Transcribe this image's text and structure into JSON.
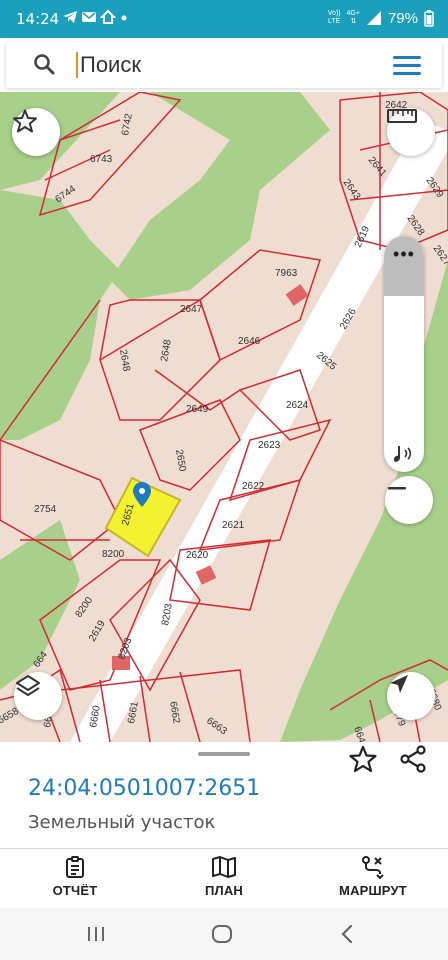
{
  "status_bar": {
    "time": "14:24",
    "left_icons": [
      "telegram-icon",
      "mail-icon",
      "home-icon",
      "dot-icon"
    ],
    "network_top": "Vo))",
    "network_bottom": "LTE",
    "network_type": "4G+",
    "battery": "79%"
  },
  "search": {
    "placeholder": "Поиск"
  },
  "map": {
    "plot_labels": [
      "6742",
      "6743",
      "6744",
      "2642",
      "2641",
      "2643",
      "2629",
      "2628",
      "2619",
      "2627",
      "7963",
      "2647",
      "2646",
      "2626",
      "2625",
      "2648",
      "2648",
      "2649",
      "2624",
      "2650",
      "2623",
      "2622",
      "2754",
      "2651",
      "2621",
      "8200",
      "8200",
      "2620",
      "2619",
      "8203",
      "8203",
      "664",
      "6658",
      "6659",
      "6660",
      "6661",
      "6662",
      "6663",
      "6680",
      "6679",
      "664"
    ],
    "selected_parcel": "2651",
    "colors": {
      "land": "#f0ddd2",
      "forest": "#a8d08a",
      "boundary": "#d42a33",
      "selected": "#f2f230",
      "building": "#e06565",
      "road": "#ffffff",
      "accent": "#1aa0bd"
    }
  },
  "parcel": {
    "cadastral_number": "24:04:0501007:2651",
    "type": "Земельный участок"
  },
  "bottom_nav": {
    "report": "ОТЧЁТ",
    "plan": "ПЛАН",
    "route": "МАРШРУТ"
  }
}
